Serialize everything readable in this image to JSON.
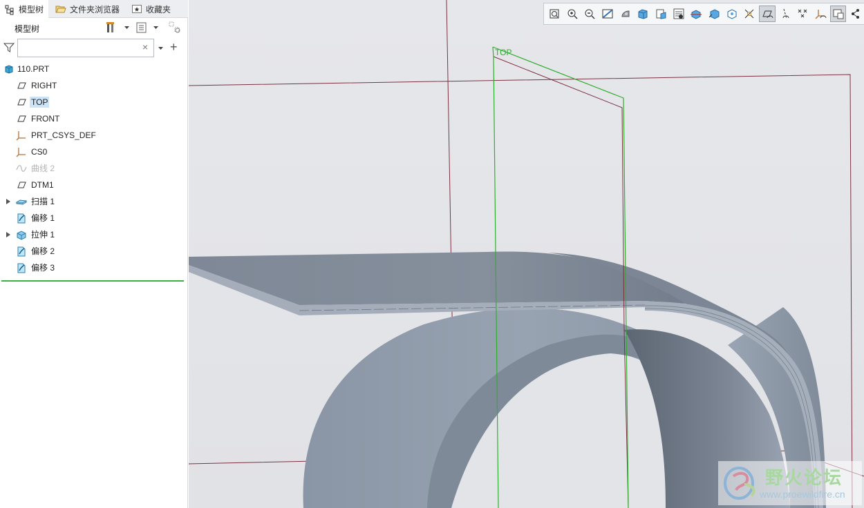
{
  "tabs": [
    {
      "label": "模型树",
      "icon": "model-tree-icon",
      "active": true
    },
    {
      "label": "文件夹浏览器",
      "icon": "folder-browser-icon",
      "active": false
    },
    {
      "label": "收藏夹",
      "icon": "favorites-icon",
      "active": false
    }
  ],
  "tree_toolbar": {
    "title": "模型树",
    "settings_icon": "tree-settings-icon",
    "columns_icon": "show-columns-icon",
    "filter_icon": "tree-filter-icon"
  },
  "search": {
    "value": "",
    "placeholder": ""
  },
  "tree": {
    "root": {
      "label": "110.PRT",
      "icon": "part-icon"
    },
    "items": [
      {
        "label": "RIGHT",
        "icon": "datum-plane-icon",
        "selected": false,
        "dimmed": false,
        "expandable": false
      },
      {
        "label": "TOP",
        "icon": "datum-plane-icon",
        "selected": true,
        "dimmed": false,
        "expandable": false
      },
      {
        "label": "FRONT",
        "icon": "datum-plane-icon",
        "selected": false,
        "dimmed": false,
        "expandable": false
      },
      {
        "label": "PRT_CSYS_DEF",
        "icon": "csys-icon",
        "selected": false,
        "dimmed": false,
        "expandable": false
      },
      {
        "label": "CS0",
        "icon": "csys-icon",
        "selected": false,
        "dimmed": false,
        "expandable": false
      },
      {
        "label": "曲线 2",
        "icon": "curve-icon",
        "selected": false,
        "dimmed": true,
        "expandable": false
      },
      {
        "label": "DTM1",
        "icon": "datum-plane-icon",
        "selected": false,
        "dimmed": false,
        "expandable": false
      },
      {
        "label": "扫描 1",
        "icon": "sweep-icon",
        "selected": false,
        "dimmed": false,
        "expandable": true
      },
      {
        "label": "偏移 1",
        "icon": "offset-icon",
        "selected": false,
        "dimmed": false,
        "expandable": false
      },
      {
        "label": "拉伸 1",
        "icon": "extrude-icon",
        "selected": false,
        "dimmed": false,
        "expandable": true
      },
      {
        "label": "偏移 2",
        "icon": "offset-icon",
        "selected": false,
        "dimmed": false,
        "expandable": false
      },
      {
        "label": "偏移 3",
        "icon": "offset-icon",
        "selected": false,
        "dimmed": false,
        "expandable": false
      }
    ]
  },
  "view_toolbar": [
    {
      "icon": "refit-icon",
      "on": false
    },
    {
      "icon": "zoom-in-icon",
      "on": false
    },
    {
      "icon": "zoom-out-icon",
      "on": false
    },
    {
      "icon": "repaint-icon",
      "on": false
    },
    {
      "icon": "display-style-icon",
      "on": false
    },
    {
      "icon": "saved-orientations-icon",
      "on": false
    },
    {
      "icon": "named-views-icon",
      "on": false
    },
    {
      "icon": "view-manager-icon",
      "on": false
    },
    {
      "icon": "section-icon",
      "on": false
    },
    {
      "icon": "perspective-icon",
      "on": false
    },
    {
      "icon": "spin-center-icon",
      "on": false
    },
    {
      "icon": "annotation-display-icon",
      "on": false
    },
    {
      "icon": "plane-display-icon",
      "on": true
    },
    {
      "icon": "axis-display-icon",
      "on": false
    },
    {
      "icon": "point-display-icon",
      "on": false
    },
    {
      "icon": "csys-display-icon",
      "on": false
    },
    {
      "icon": "tag-display-icon",
      "on": true
    },
    {
      "icon": "more-tools-icon",
      "on": false
    }
  ],
  "viewport": {
    "datum_label": "TOP",
    "model_color": "#8f9aa8",
    "datum_plane_color": "#2fae2f",
    "datum_edge_color": "#7a2a3a"
  },
  "watermark": {
    "title": "野火论坛",
    "url": "www.proewildfire.cn"
  }
}
